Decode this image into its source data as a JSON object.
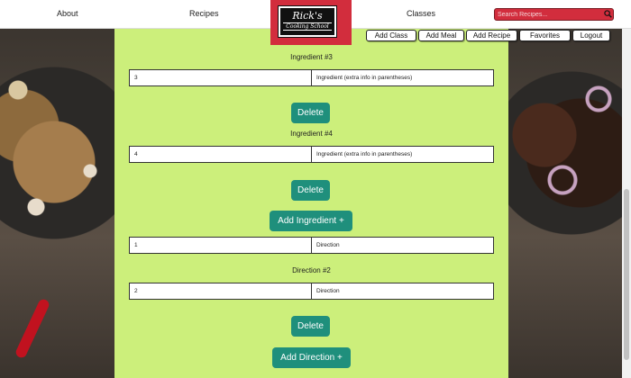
{
  "nav": {
    "about": "About",
    "recipes": "Recipes",
    "classes": "Classes",
    "search_placeholder": "Search Recipes..."
  },
  "logo": {
    "name": "Rick's",
    "subtitle": "Cooking School"
  },
  "actions": {
    "add_class": "Add Class",
    "add_meal": "Add Meal",
    "add_recipe": "Add Recipe",
    "favorites": "Favorites",
    "logout": "Logout"
  },
  "form": {
    "ingredient3_label": "Ingredient #3",
    "ingredient3_amount": "3",
    "ingredient3_name": "Ingredient (extra info in parentheses)",
    "ingredient4_label": "Ingredient #4",
    "ingredient4_amount": "4",
    "ingredient4_name": "Ingredient (extra info in parentheses)",
    "delete": "Delete",
    "add_ingredient": "Add Ingredient +",
    "direction1_step": "1",
    "direction1_text": "Direction",
    "direction2_label": "Direction #2",
    "direction2_step": "2",
    "direction2_text": "Direction",
    "add_direction": "Add Direction +"
  },
  "colors": {
    "panel": "#ccef7b",
    "accent": "#1f8f7c",
    "brand": "#d22d3d"
  }
}
